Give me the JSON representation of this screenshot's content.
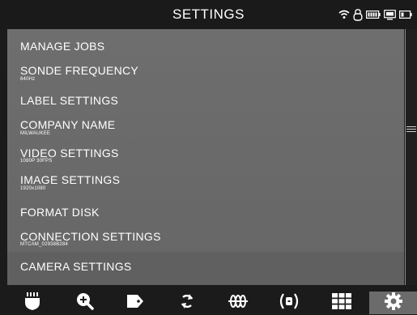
{
  "header": {
    "title": "SETTINGS"
  },
  "status_icons": [
    "wifi-icon",
    "lock-icon",
    "battery-full-icon",
    "monitor-icon",
    "battery-icon"
  ],
  "menu": [
    {
      "label": "MANAGE JOBS",
      "sub": ""
    },
    {
      "label": "SONDE FREQUENCY",
      "sub": "640Hz"
    },
    {
      "label": "LABEL SETTINGS",
      "sub": ""
    },
    {
      "label": "COMPANY NAME",
      "sub": "MILWAUKEE"
    },
    {
      "label": "VIDEO SETTINGS",
      "sub": "1080P  30FPS"
    },
    {
      "label": "IMAGE SETTINGS",
      "sub": "1920x1080"
    },
    {
      "label": "FORMAT DISK",
      "sub": ""
    },
    {
      "label": "CONNECTION SETTINGS",
      "sub": "MTCAM_02938B284"
    },
    {
      "label": "CAMERA SETTINGS",
      "sub": ""
    }
  ],
  "toolbar": [
    "camera-head-icon",
    "zoom-in-icon",
    "tag-icon",
    "rotate-icon",
    "sonde-icon",
    "transmitter-icon",
    "grid-icon",
    "settings-gear-icon"
  ],
  "colors": {
    "panel": "#6c6c6c",
    "active_tab": "#6b6b6b",
    "background": "#1b1b1b"
  }
}
